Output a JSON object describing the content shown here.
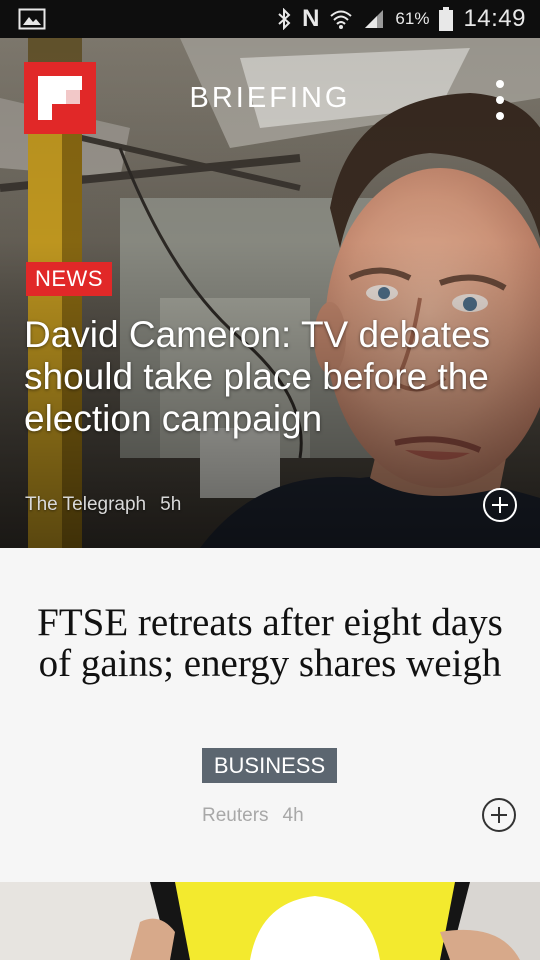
{
  "status_bar": {
    "icons": [
      "gallery-icon",
      "bluetooth-icon",
      "nfc-icon",
      "wifi-icon",
      "signal-icon",
      "battery-icon"
    ],
    "nfc_letter": "N",
    "battery": "61%",
    "time": "14:49"
  },
  "header": {
    "title": "BRIEFING"
  },
  "hero": {
    "tag": "NEWS",
    "tag_color": "#e12828",
    "headline": "David Cameron: TV debates should take place before the election campaign",
    "source": "The Telegraph",
    "age": "5h"
  },
  "card2": {
    "headline": "FTSE retreats after eight days of gains; energy shares weigh",
    "tag": "BUSINESS",
    "tag_color": "#5c6670",
    "source": "Reuters",
    "age": "4h"
  },
  "colors": {
    "brand": "#e12828",
    "status_bar": "#0e0e0e",
    "card_bg": "#f6f6f6",
    "snapchat_yellow": "#f3ea2e"
  }
}
